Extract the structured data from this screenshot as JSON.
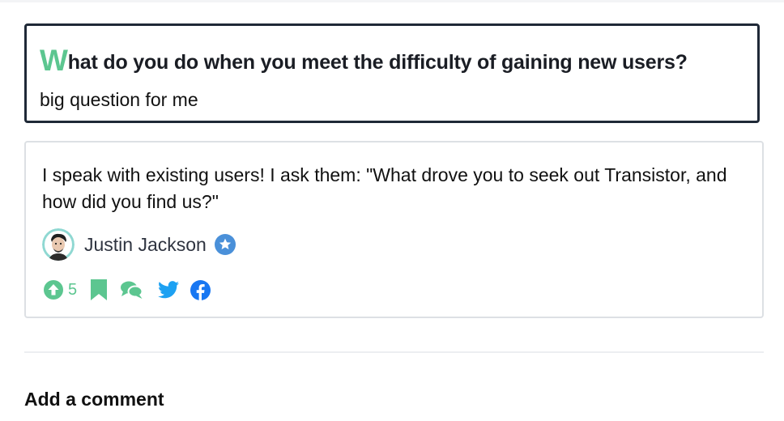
{
  "question": {
    "title_initial": "W",
    "title_rest": "hat do you do when you meet the difficulty of gaining new users?",
    "subtitle": "big question for me"
  },
  "answer": {
    "text": "I speak with existing users! I ask them: \"What drove you to seek out Transistor, and how did you find us?\"",
    "author": {
      "name": "Justin Jackson",
      "avatar_icon": "user-avatar",
      "badge_icon": "verified-star-icon"
    },
    "actions": {
      "upvote_count": "5",
      "icons": [
        "upvote-icon",
        "bookmark-icon",
        "comment-icon",
        "twitter-icon",
        "facebook-icon"
      ]
    }
  },
  "comments": {
    "heading": "Add a comment"
  },
  "colors": {
    "accent_green": "#5cc690",
    "brand_blue": "#4a90d9",
    "twitter_blue": "#1da1f2",
    "facebook_blue": "#1877f2",
    "dark_border": "#1f2937",
    "light_border": "#dde0e4"
  }
}
